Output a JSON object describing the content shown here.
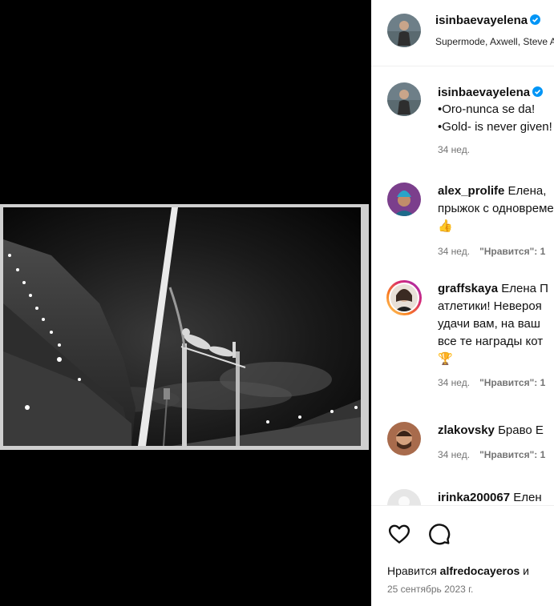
{
  "post": {
    "author": "isinbaevayelena",
    "audio_subtitle": "Supermode, Axwell, Steve Angello · Tell me why",
    "caption_line1": "•Oro-nunca se da!",
    "caption_line2": "•Gold- is never given!",
    "caption_age": "34 нед."
  },
  "comments": [
    {
      "user": "alex_prolife",
      "text1": "Елена,",
      "text2": "прыжок с одновременно...",
      "emoji": "👍",
      "age": "34 нед.",
      "reply": "\"Нравится\": 1"
    },
    {
      "user": "graffskaya",
      "text1": "Елена П",
      "text2": "атлетики! Невероя",
      "text3": "удачи вам, на ваш",
      "text4": "все те награды кот",
      "emoji": "🏆",
      "age": "34 нед.",
      "reply": "\"Нравится\": 1"
    },
    {
      "user": "zlakovsky",
      "text1": "Браво Е",
      "age": "34 нед.",
      "reply": "\"Нравится\": 1"
    },
    {
      "user": "irinka200067",
      "text1": "Елен"
    }
  ],
  "footer": {
    "likes_prefix": "Нравится",
    "likes_user": "alfredocayeros",
    "likes_suffix": "и",
    "date": "25 сентябрь 2023 г."
  },
  "colors": {
    "verified": "#0095f6",
    "meta": "#737373",
    "story_ring": "#d6249f"
  },
  "icons": [
    "heart-icon",
    "comment-icon",
    "verified-badge-icon"
  ]
}
